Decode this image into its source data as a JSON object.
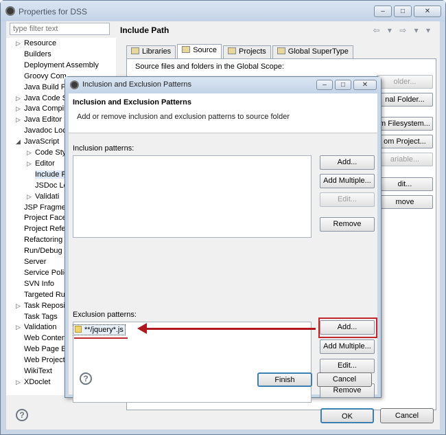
{
  "window": {
    "title": "Properties for DSS",
    "minimize": "–",
    "maximize": "□",
    "close": "✕"
  },
  "filter": {
    "placeholder": "type filter text"
  },
  "nav": [
    {
      "label": "Resource",
      "expandable": true
    },
    {
      "label": "Builders",
      "expandable": false
    },
    {
      "label": "Deployment Assembly",
      "expandable": false
    },
    {
      "label": "Groovy Com",
      "expandable": false
    },
    {
      "label": "Java Build Pa",
      "expandable": false
    },
    {
      "label": "Java Code S",
      "expandable": true
    },
    {
      "label": "Java Compil",
      "expandable": true
    },
    {
      "label": "Java Editor",
      "expandable": true
    },
    {
      "label": "Javadoc Loc",
      "expandable": false
    },
    {
      "label": "JavaScript",
      "expandable": true,
      "expanded": true
    },
    {
      "label": "Code Sty",
      "expandable": true,
      "indent": 1
    },
    {
      "label": "Editor",
      "expandable": true,
      "indent": 1
    },
    {
      "label": "Include P",
      "expandable": false,
      "indent": 1,
      "selected": true
    },
    {
      "label": "JSDoc Lo",
      "expandable": false,
      "indent": 1
    },
    {
      "label": "Validati",
      "expandable": true,
      "indent": 1
    },
    {
      "label": "JSP Fragmen",
      "expandable": false
    },
    {
      "label": "Project Face",
      "expandable": false
    },
    {
      "label": "Project Refer",
      "expandable": false
    },
    {
      "label": "Refactoring",
      "expandable": false
    },
    {
      "label": "Run/Debug",
      "expandable": false
    },
    {
      "label": "Server",
      "expandable": false
    },
    {
      "label": "Service Polic",
      "expandable": false
    },
    {
      "label": "SVN Info",
      "expandable": false
    },
    {
      "label": "Targeted Ru",
      "expandable": false
    },
    {
      "label": "Task Reposit",
      "expandable": true
    },
    {
      "label": "Task Tags",
      "expandable": false
    },
    {
      "label": "Validation",
      "expandable": true
    },
    {
      "label": "Web Conten",
      "expandable": false
    },
    {
      "label": "Web Page E",
      "expandable": false
    },
    {
      "label": "Web Project",
      "expandable": false
    },
    {
      "label": "WikiText",
      "expandable": false
    },
    {
      "label": "XDoclet",
      "expandable": true
    }
  ],
  "page": {
    "title": "Include Path",
    "nav_arrows": "⇦ ▾ ⇨ ▾ ▾",
    "tabs": [
      "Libraries",
      "Source",
      "Projects",
      "Global SuperType"
    ],
    "scope_text": "Source files and folders in the Global Scope:",
    "right_buttons": [
      "older...",
      "nal Folder...",
      "m Filesystem...",
      "om Project...",
      "ariable...",
      "dit...",
      "move"
    ]
  },
  "footer": {
    "help": "?",
    "ok": "OK",
    "cancel": "Cancel"
  },
  "dialog": {
    "title": "Inclusion and Exclusion Patterns",
    "minimize": "–",
    "maximize": "□",
    "close": "✕",
    "banner_title": "Inclusion and Exclusion Patterns",
    "banner_sub": "Add or remove inclusion and exclusion patterns to source folder",
    "inclusion_label": "Inclusion patterns:",
    "exclusion_label": "Exclusion patterns:",
    "inc_buttons": {
      "add": "Add...",
      "add_multiple": "Add Multiple...",
      "edit": "Edit...",
      "remove": "Remove"
    },
    "exc_buttons": {
      "add": "Add...",
      "add_multiple": "Add Multiple...",
      "edit": "Edit...",
      "remove": "Remove"
    },
    "exclusion_patterns": [
      "**/jquery*.js"
    ],
    "help": "?",
    "finish": "Finish",
    "cancel": "Cancel"
  }
}
